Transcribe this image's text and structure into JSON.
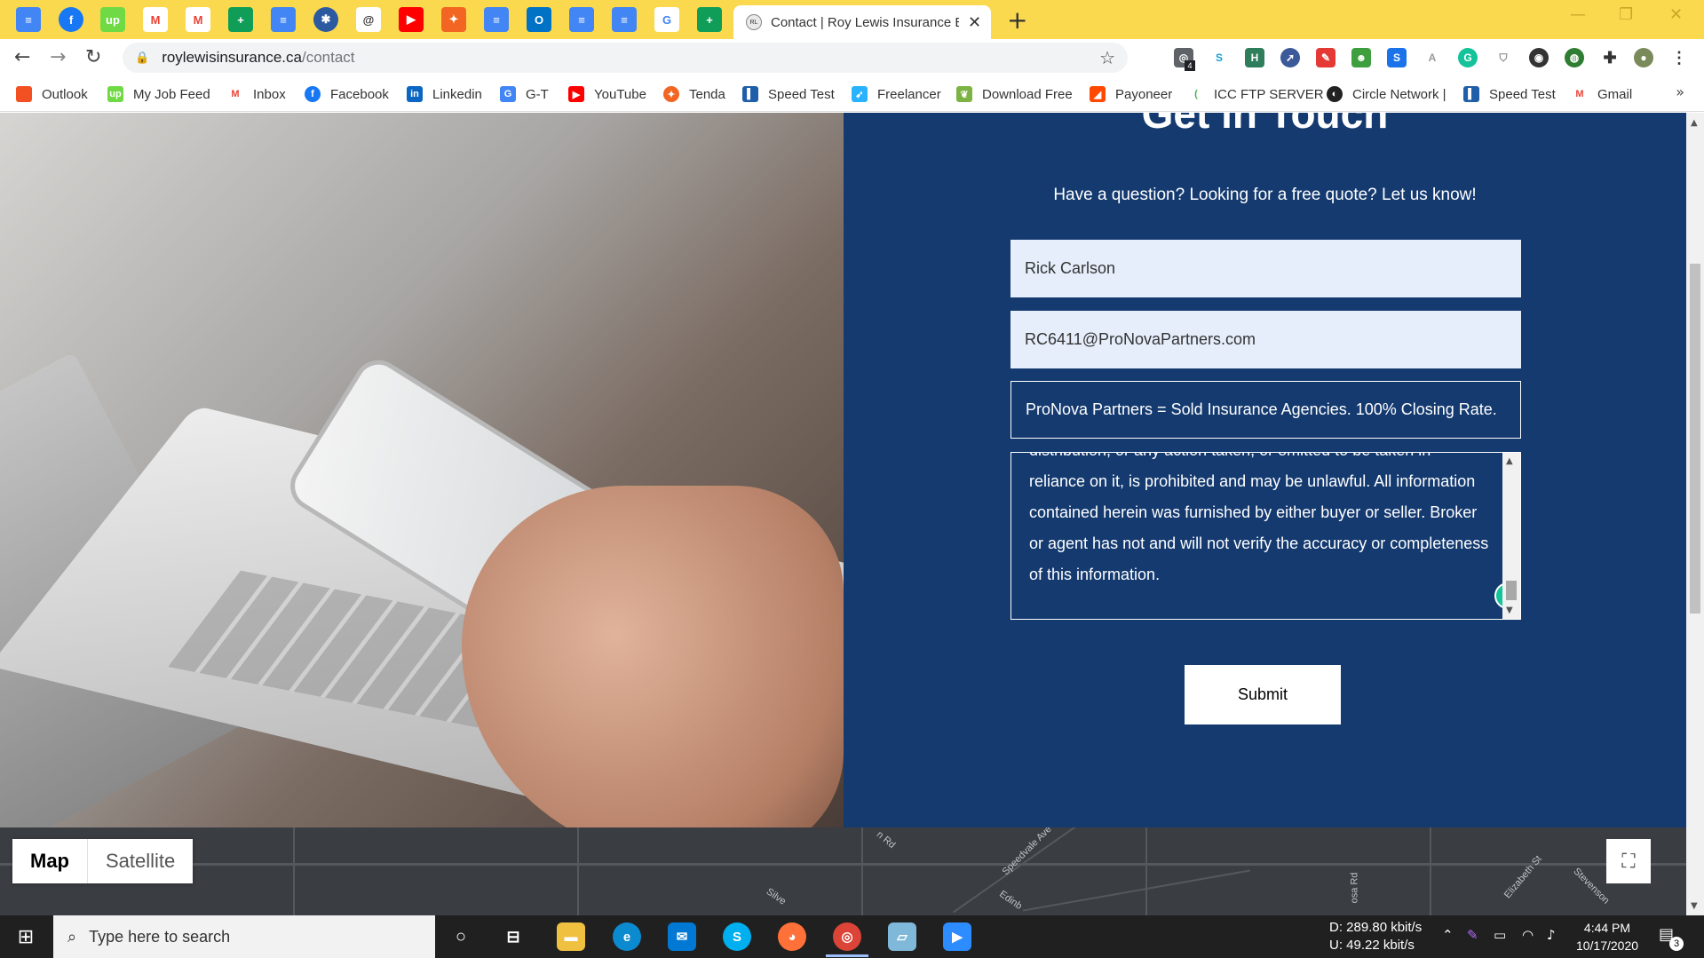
{
  "browser": {
    "active_tab_title": "Contact | Roy Lewis Insurance Br",
    "url_host": "roylewisinsurance.ca",
    "url_path": "/contact",
    "bookmarks": [
      {
        "label": "Outlook"
      },
      {
        "label": "My Job Feed"
      },
      {
        "label": "Inbox"
      },
      {
        "label": "Facebook"
      },
      {
        "label": "Linkedin"
      },
      {
        "label": "G-T"
      },
      {
        "label": "YouTube"
      },
      {
        "label": "Tenda"
      },
      {
        "label": "Speed Test"
      },
      {
        "label": "Freelancer"
      },
      {
        "label": "Download Free"
      },
      {
        "label": "Payoneer"
      },
      {
        "label": "ICC FTP SERVER"
      },
      {
        "label": "Circle Network |"
      },
      {
        "label": "Speed Test"
      },
      {
        "label": "Gmail"
      }
    ],
    "extension_badge": "4"
  },
  "page": {
    "heading": "Get in Touch",
    "subheading": "Have a question? Looking for a free quote? Let us know!",
    "form": {
      "name_value": "Rick Carlson",
      "email_value": "RC6411@ProNovaPartners.com",
      "subject_value": "ProNova Partners = Sold Insurance Agencies.  100% Closing Rate.",
      "message_value": "distribution, or any action taken, or omitted to be taken in reliance on it, is prohibited and may be unlawful.  All information contained herein was furnished by either buyer or seller.  Broker or agent has not and will not verify the accuracy or completeness of this information.",
      "submit_label": "Submit",
      "grammarly_letter": "G"
    },
    "map": {
      "map_label": "Map",
      "satellite_label": "Satellite",
      "street_labels": [
        "n Rd",
        "Speedvale Ave",
        "Edinb",
        "Silve",
        "osa Rd",
        "Elizabeth St",
        "Stevenson"
      ]
    }
  },
  "taskbar": {
    "search_placeholder": "Type here to search",
    "net_down": "D:  289.80 kbit/s",
    "net_up": "U:   49.22 kbit/s",
    "time": "4:44 PM",
    "date": "10/17/2020",
    "notification_count": "3"
  },
  "colors": {
    "tabstrip": "#fbd94f",
    "panel_blue": "#143a70",
    "field_fill": "#e6eefb"
  }
}
